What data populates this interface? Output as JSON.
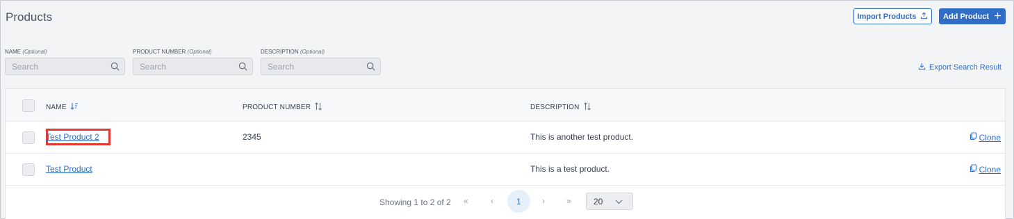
{
  "header": {
    "title": "Products",
    "import_label": "Import Products",
    "add_label": "Add Product"
  },
  "filters": [
    {
      "label": "NAME",
      "optional": "(Optional)",
      "placeholder": "Search"
    },
    {
      "label": "PRODUCT NUMBER",
      "optional": "(Optional)",
      "placeholder": "Search"
    },
    {
      "label": "DESCRIPTION",
      "optional": "(Optional)",
      "placeholder": "Search"
    }
  ],
  "export_label": "Export Search Result",
  "table": {
    "columns": [
      "NAME",
      "PRODUCT NUMBER",
      "DESCRIPTION"
    ],
    "rows": [
      {
        "name": "Test Product 2",
        "number": "2345",
        "description": "This is another test product.",
        "action": "Clone",
        "highlighted": true
      },
      {
        "name": "Test Product",
        "number": "",
        "description": "This is a test product.",
        "action": "Clone",
        "highlighted": false
      }
    ]
  },
  "pagination": {
    "showing": "Showing 1 to 2 of 2",
    "first": "«",
    "prev": "‹",
    "current_page": "1",
    "next": "›",
    "last": "»",
    "page_size": "20"
  },
  "colors": {
    "accent": "#2f6dc6",
    "highlight": "#e53935",
    "background": "#f3f4f6"
  }
}
